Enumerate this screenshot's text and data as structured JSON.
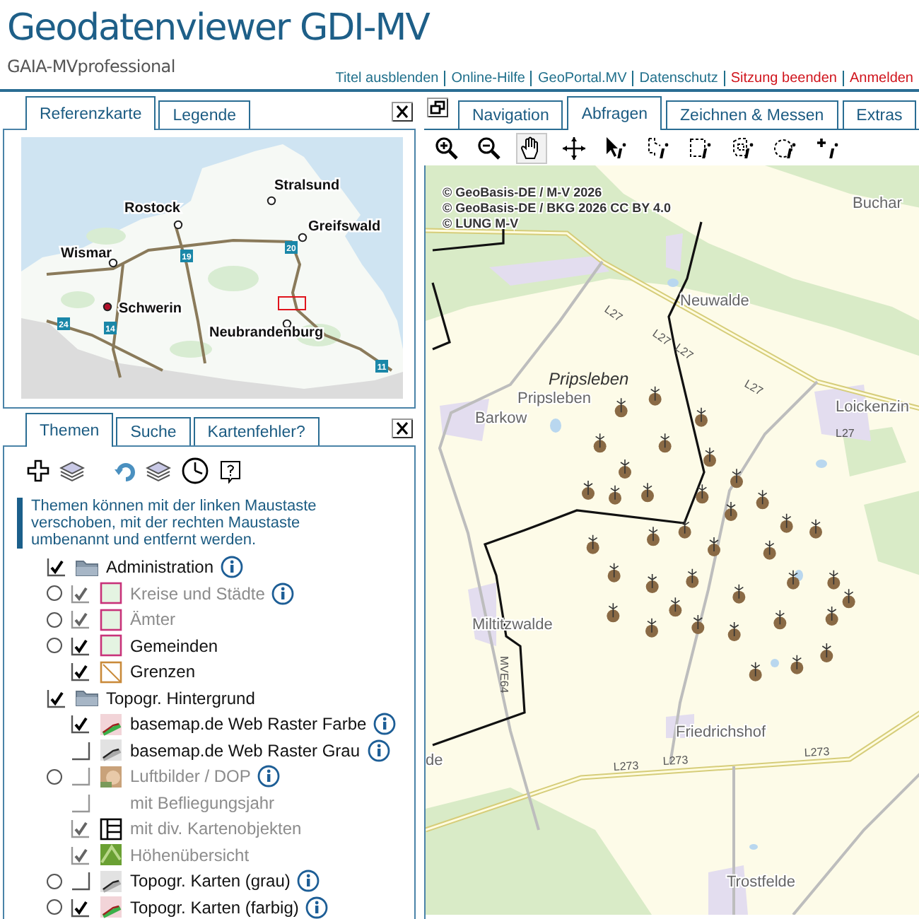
{
  "header": {
    "title": "Geodatenviewer GDI-MV",
    "subtitle": "GAIA-MVprofessional",
    "links": [
      {
        "label": "Titel ausblenden",
        "color": "#1f6f8b"
      },
      {
        "label": "Online-Hilfe",
        "color": "#1f6f8b"
      },
      {
        "label": "GeoPortal.MV",
        "color": "#1f6f8b"
      },
      {
        "label": "Datenschutz",
        "color": "#1f6f8b"
      },
      {
        "label": "Sitzung beenden",
        "color": "#d0141c"
      },
      {
        "label": "Anmelden",
        "color": "#d0141c"
      }
    ]
  },
  "reference_panel": {
    "tabs": [
      {
        "label": "Referenzkarte",
        "selected": true
      },
      {
        "label": "Legende",
        "selected": false
      }
    ],
    "cities": [
      "Stralsund",
      "Rostock",
      "Greifswald",
      "Wismar",
      "Schwerin",
      "Neubrandenburg"
    ],
    "road_numbers": [
      "19",
      "20",
      "24",
      "14",
      "11"
    ]
  },
  "themes_panel": {
    "tabs": [
      {
        "label": "Themen",
        "selected": true
      },
      {
        "label": "Suche",
        "selected": false
      },
      {
        "label": "Kartenfehler?",
        "selected": false
      }
    ],
    "hint": "Themen können mit der linken Maustaste verschoben, mit der rechten Maustaste umbenannt und entfernt werden.",
    "tree": [
      {
        "label": "Administration",
        "checked": true,
        "kind": "folder",
        "info": true,
        "disabled": false,
        "children": [
          {
            "label": "Kreise und Städte",
            "radio_selected": false,
            "checked": true,
            "kind": "area",
            "info": true,
            "disabled": true
          },
          {
            "label": "Ämter",
            "radio_selected": false,
            "checked": true,
            "kind": "area",
            "info": false,
            "disabled": true
          },
          {
            "label": "Gemeinden",
            "radio_selected": false,
            "checked": true,
            "kind": "area",
            "info": false,
            "disabled": false
          },
          {
            "label": "Grenzen",
            "checked": true,
            "kind": "line",
            "info": false,
            "disabled": false
          }
        ]
      },
      {
        "label": "Topogr. Hintergrund",
        "checked": true,
        "kind": "folder",
        "info": false,
        "disabled": false,
        "children": [
          {
            "label": "basemap.de Web Raster Farbe",
            "checked": true,
            "kind": "colormap",
            "info": true,
            "disabled": false
          },
          {
            "label": "basemap.de Web Raster Grau",
            "checked": false,
            "kind": "greymap",
            "info": true,
            "disabled": false
          },
          {
            "label": "Luftbilder / DOP",
            "radio_selected": false,
            "checked": false,
            "kind": "aerial",
            "info": true,
            "disabled": true
          },
          {
            "label": "mit Befliegungsjahr",
            "checked": false,
            "kind": "plain",
            "info": false,
            "disabled": true
          },
          {
            "label": "mit div. Kartenobjekten",
            "checked": true,
            "kind": "grid",
            "info": false,
            "disabled": true
          },
          {
            "label": "Höhenübersicht",
            "checked": true,
            "kind": "relief",
            "info": false,
            "disabled": true
          },
          {
            "label": "Topogr. Karten (grau)",
            "radio_selected": false,
            "checked": false,
            "kind": "greymap",
            "info": true,
            "disabled": false
          },
          {
            "label": "Topogr. Karten (farbig)",
            "radio_selected": false,
            "checked": true,
            "kind": "colormap",
            "info": true,
            "disabled": false
          }
        ]
      }
    ]
  },
  "map_panel": {
    "tabs": [
      {
        "label": "Navigation",
        "selected": false
      },
      {
        "label": "Abfragen",
        "selected": true
      },
      {
        "label": "Zeichnen & Messen",
        "selected": false
      },
      {
        "label": "Extras",
        "selected": false
      }
    ],
    "tools": [
      {
        "selected": false
      },
      {
        "selected": false
      },
      {
        "selected": true
      },
      {
        "selected": false
      },
      {
        "selected": false
      },
      {
        "selected": false
      },
      {
        "selected": false
      },
      {
        "selected": false
      },
      {
        "selected": false
      },
      {
        "selected": false
      }
    ],
    "attribution": [
      "© GeoBasis-DE / M-V 2026",
      "© GeoBasis-DE / BKG 2026 CC BY 4.0",
      "© LUNG M-V"
    ],
    "places": [
      "Buchar",
      "Neuwalde",
      "Pripsleben",
      "Barkow",
      "Loickenzin",
      "Miltitzwalde",
      "Friedrichshof",
      "Trostfelde",
      "de"
    ],
    "municipality_label": "Pripsleben",
    "road_labels": [
      "L27",
      "L27",
      "L27",
      "L27",
      "L27",
      "L273",
      "L273",
      "L273",
      "MVE64"
    ]
  }
}
